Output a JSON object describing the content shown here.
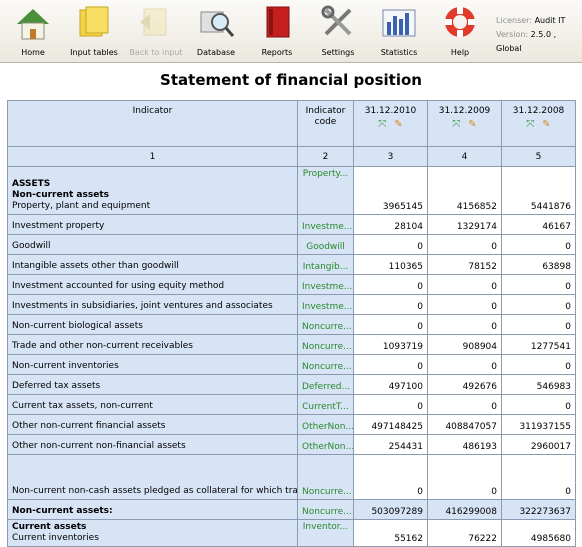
{
  "toolbar": {
    "home": "Home",
    "input_tables": "Input tables",
    "back_to_input": "Back to input",
    "database": "Database",
    "reports": "Reports",
    "settings": "Settings",
    "statistics": "Statistics",
    "help": "Help"
  },
  "license": {
    "licenser_label": "Licenser:",
    "licenser_value": "Audit IT",
    "version_label": "Version:",
    "version_value": "2.5.0 , Global"
  },
  "report": {
    "title": "Statement of financial position",
    "columns": {
      "indicator": "Indicator",
      "indicator_code": "Indicator code",
      "d1": "31.12.2010",
      "d2": "31.12.2009",
      "d3": "31.12.2008"
    },
    "numbers": [
      "1",
      "2",
      "3",
      "4",
      "5"
    ],
    "rows": [
      {
        "header1": "ASSETS",
        "header2": "Non-current assets",
        "label": "Property, plant and equipment",
        "code": "Property...",
        "v1": "3965145",
        "v2": "4156852",
        "v3": "5441876"
      },
      {
        "label": "Investment property",
        "code": "Investme...",
        "v1": "28104",
        "v2": "1329174",
        "v3": "46167"
      },
      {
        "label": "Goodwill",
        "code": "Goodwill",
        "v1": "0",
        "v2": "0",
        "v3": "0"
      },
      {
        "label": "Intangible assets other than goodwill",
        "code": "Intangib...",
        "v1": "110365",
        "v2": "78152",
        "v3": "63898"
      },
      {
        "label": "Investment accounted for using equity method",
        "code": "Investme...",
        "v1": "0",
        "v2": "0",
        "v3": "0"
      },
      {
        "label": "Investments in subsidiaries, joint ventures and associates",
        "code": "Investme...",
        "v1": "0",
        "v2": "0",
        "v3": "0"
      },
      {
        "label": "Non-current biological assets",
        "code": "Noncurre...",
        "v1": "0",
        "v2": "0",
        "v3": "0"
      },
      {
        "label": "Trade and other non-current receivables",
        "code": "Noncurre...",
        "v1": "1093719",
        "v2": "908904",
        "v3": "1277541"
      },
      {
        "label": "Non-current inventories",
        "code": "Noncurre...",
        "v1": "0",
        "v2": "0",
        "v3": "0"
      },
      {
        "label": "Deferred tax assets",
        "code": "Deferred...",
        "v1": "497100",
        "v2": "492676",
        "v3": "546983"
      },
      {
        "label": "Current tax assets, non-current",
        "code": "CurrentT...",
        "v1": "0",
        "v2": "0",
        "v3": "0"
      },
      {
        "label": "Other non-current financial assets",
        "code": "OtherNon...",
        "v1": "497148425",
        "v2": "408847057",
        "v3": "311937155"
      },
      {
        "label": "Other non-current non-financial assets",
        "code": "OtherNon...",
        "v1": "254431",
        "v2": "486193",
        "v3": "2960017"
      },
      {
        "label": "Non-current non-cash assets pledged as collateral for which transferee has right by contract or custom to sell or repledge collateral",
        "code": "Noncurre...",
        "v1": "0",
        "v2": "0",
        "v3": "0"
      },
      {
        "label": "Non-current assets:",
        "code": "Noncurre...",
        "v1": "503097289",
        "v2": "416299008",
        "v3": "322273637",
        "total": true
      },
      {
        "header1": "Current assets",
        "label": "Current inventories",
        "code": "Inventor...",
        "v1": "55162",
        "v2": "76222",
        "v3": "4985680"
      }
    ]
  }
}
